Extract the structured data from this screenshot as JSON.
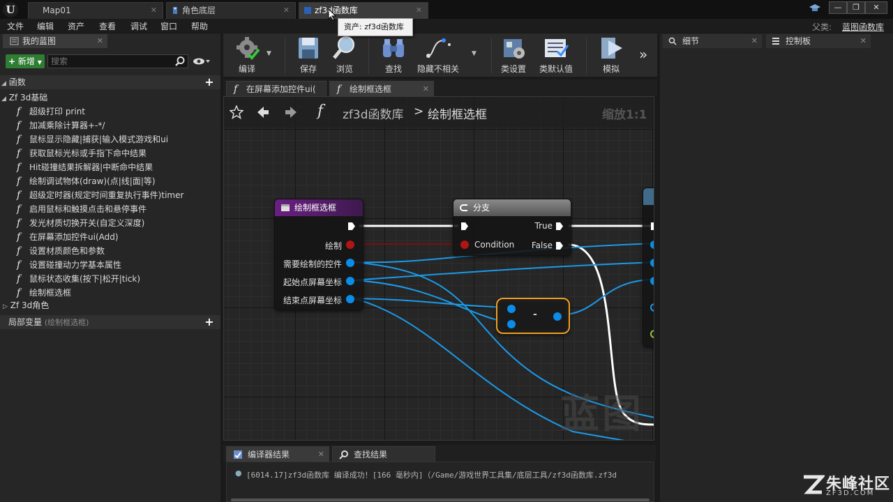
{
  "titlebar": {
    "tabs": [
      {
        "label": "Map01"
      },
      {
        "label": "角色底层"
      },
      {
        "label": "zf3d函数库"
      }
    ]
  },
  "tooltip": {
    "text": "资产: zf3d函数库"
  },
  "menubar": {
    "items": [
      "文件",
      "编辑",
      "资产",
      "查看",
      "调试",
      "窗口",
      "帮助"
    ],
    "parent_label": "父类:",
    "parent_value": "蓝图函数库"
  },
  "left_panel": {
    "tab_label": "我的蓝图",
    "new_button": "新增",
    "search_placeholder": "搜索",
    "functions_section": "函数",
    "category_open": "Zf 3d基础",
    "category_closed": "Zf 3d角色",
    "functions": [
      "超级打印 print",
      "加减乘除计算器+-*/",
      "鼠标显示隐藏|捕获|输入模式游戏和ui",
      "获取鼠标光标或手指下命中结果",
      "Hit碰撞结果拆解器|中断命中结果",
      "绘制调试物体(draw)(点|线|面|等)",
      "超级定时器(规定时间重复执行事件)timer",
      "启用鼠标和触摸点击和悬停事件",
      "发光材质切换开关(自定义深度)",
      "在屏幕添加控件ui(Add)",
      "设置材质颜色和参数",
      "设置碰撞动力学基本属性",
      "鼠标状态收集(按下|松开|tick)",
      "绘制框选框"
    ],
    "local_vars": "局部变量",
    "local_vars_sub": "(绘制框选框)"
  },
  "toolbar": {
    "compile": "编译",
    "save": "保存",
    "browse": "浏览",
    "find": "查找",
    "hide_unrelated": "隐藏不相关",
    "class_settings": "类设置",
    "class_defaults": "类默认值",
    "simulate": "模拟"
  },
  "graph_tabs": [
    "在屏幕添加控件ui(",
    "绘制框选框"
  ],
  "graph": {
    "breadcrumb_lib": "zf3d函数库",
    "breadcrumb_sep": ">",
    "breadcrumb_func": "绘制框选框",
    "zoom": "缩放1:1",
    "watermark": "蓝图",
    "func_node": {
      "title": "绘制框选框",
      "pins": [
        "绘制",
        "需要绘制的控件",
        "起始点屏幕坐标",
        "结束点屏幕坐标"
      ]
    },
    "branch_node": {
      "title": "分支",
      "condition": "Condition",
      "true_label": "True",
      "false_label": "False"
    },
    "minus_node": {
      "label": "-"
    }
  },
  "bottom": {
    "tabs": [
      "编译器结果",
      "查找结果"
    ],
    "log": "[6014.17]zf3d函数库 编译成功！[166 毫秒内]（/Game/游戏世界工具集/底层工具/zf3d函数库.zf3d"
  },
  "right_panel": {
    "tabs": [
      "细节",
      "控制板"
    ]
  },
  "brand": {
    "name": "朱峰社区",
    "url": "ZF3D.COM"
  },
  "colors": {
    "exec_white": "#ffffff",
    "bool_red": "#b01515",
    "object_blue": "#0a8ce8",
    "function_purple": "#6a1f83",
    "selected_orange": "#f0a020",
    "new_button_green": "#2e7d32"
  }
}
